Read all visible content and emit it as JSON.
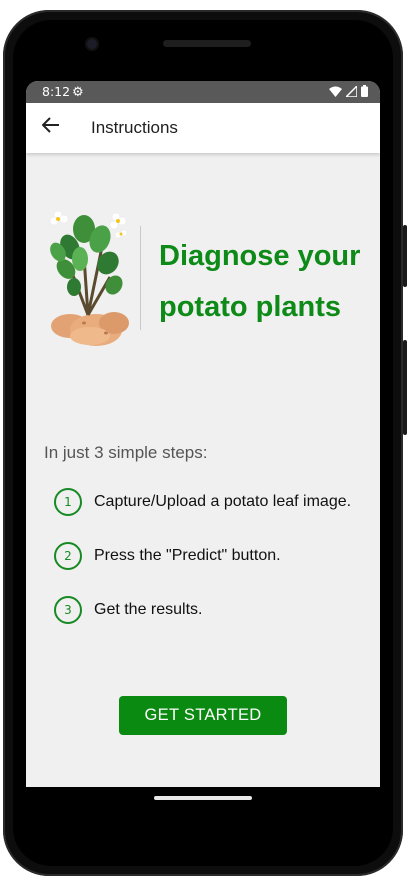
{
  "status_bar": {
    "time": "8:12",
    "icons": [
      "gear-icon",
      "wifi-icon",
      "signal-icon",
      "battery-icon"
    ]
  },
  "app_bar": {
    "back_icon": "arrow-left-icon",
    "title": "Instructions"
  },
  "hero": {
    "illustration": "potato-plant-illustration",
    "headline": "Diagnose your potato plants"
  },
  "steps_intro": "In just 3 simple steps:",
  "steps": [
    {
      "number": "1",
      "text": "Capture/Upload a potato leaf image."
    },
    {
      "number": "2",
      "text": "Press the \"Predict\" button."
    },
    {
      "number": "3",
      "text": "Get the results."
    }
  ],
  "cta": {
    "label": "GET STARTED"
  },
  "colors": {
    "accent_green": "#0a8a10",
    "headline_green": "#0d8a17",
    "screen_bg": "#f0f0f0",
    "status_bar_bg": "#595959"
  }
}
